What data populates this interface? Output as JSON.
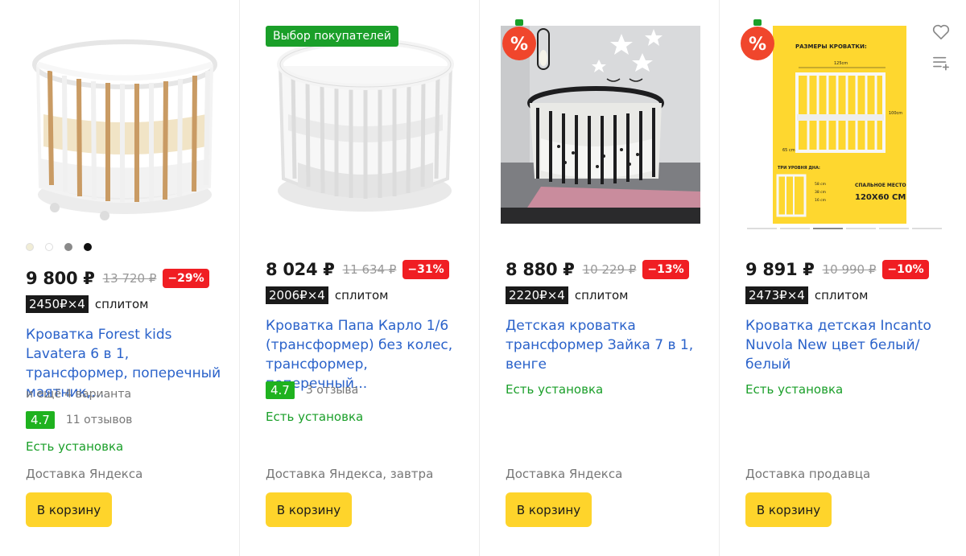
{
  "products": [
    {
      "badge": "",
      "price": "9 800 ₽",
      "old_price": "13 720 ₽",
      "discount": "−29%",
      "split": "2450₽×4",
      "split_label": "сплитом",
      "title": "Кроватка Forest kids Lavatera 6 в 1, трансформер, поперечный маятник,...",
      "variants": "и ещё 4 варианта",
      "rating": "4.7",
      "reviews": "11 отзывов",
      "install": "Есть установка",
      "delivery": "Доставка Яндекса",
      "cart_label": "В корзину",
      "color_dots": [
        "#f1edd6",
        "#ffffff",
        "#8a8a8a",
        "#111111"
      ]
    },
    {
      "badge": "Выбор покупателей",
      "price": "8 024 ₽",
      "old_price": "11 634 ₽",
      "discount": "−31%",
      "split": "2006₽×4",
      "split_label": "сплитом",
      "title": "Кроватка Папа Карло 1/6 (трансформер) без колес, трансформер, поперечный...",
      "variants": "",
      "rating": "4.7",
      "reviews": "3 отзыва",
      "install": "Есть установка",
      "delivery": "Доставка Яндекса, завтра",
      "cart_label": "В корзину"
    },
    {
      "badge": "%",
      "price": "8 880 ₽",
      "old_price": "10 229 ₽",
      "discount": "−13%",
      "split": "2220₽×4",
      "split_label": "сплитом",
      "title": "Детская кроватка трансформер Зайка 7 в 1, венге",
      "variants": "",
      "rating": "",
      "reviews": "",
      "install": "Есть установка",
      "delivery": "Доставка Яндекса",
      "cart_label": "В корзину"
    },
    {
      "badge": "%",
      "price": "9 891 ₽",
      "old_price": "10 990 ₽",
      "discount": "−10%",
      "split": "2473₽×4",
      "split_label": "сплитом",
      "title": "Кроватка детская Incanto Nuvola New цвет белый/белый",
      "variants": "",
      "rating": "",
      "reviews": "",
      "install": "Есть установка",
      "delivery": "Доставка продавца",
      "cart_label": "В корзину",
      "image_text": {
        "heading": "РАЗМЕРЫ КРОВАТКИ:",
        "width": "125cm",
        "height": "100cm",
        "leg": "65 cm",
        "levels_label": "ТРИ УРОВНЯ ДНА:",
        "level_1": "58 cm",
        "level_2": "38 cm",
        "level_3": "16 cm",
        "sleep_label": "СПАЛЬНОЕ МЕСТО",
        "sleep_size": "120X60 СМ"
      }
    }
  ],
  "colors": {
    "link": "#2a62ca",
    "price_discount": "#f01e23",
    "rating": "#1fb21f",
    "install": "#1a9f29",
    "cart": "#fed42b",
    "choice_badge": "#1a9f29"
  },
  "icons": [
    "heart-icon",
    "compare-list-icon",
    "sale-percent-icon"
  ]
}
